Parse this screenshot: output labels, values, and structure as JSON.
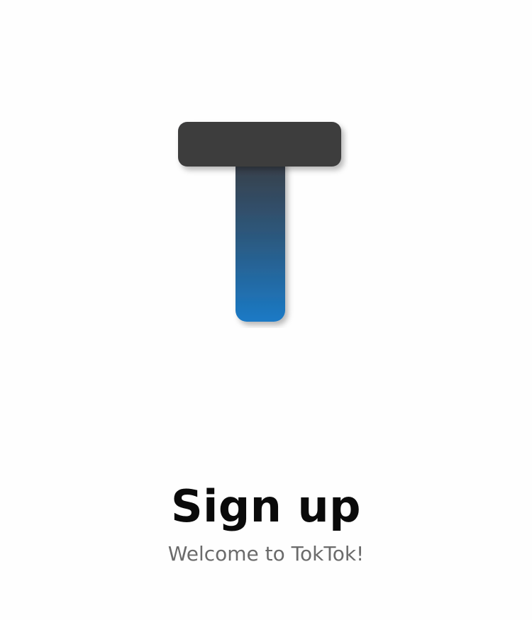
{
  "app": {
    "name": "TokTok",
    "logo_icon": "toktok-t-logo-icon",
    "colors": {
      "logo_dark": "#3c3c3e",
      "logo_blue": "#1b7ac6",
      "title": "#0a0a0a",
      "subtitle": "#6b6b6b",
      "background": "#fefefe"
    }
  },
  "header": {
    "title": "Sign up",
    "subtitle": "Welcome to TokTok!"
  }
}
